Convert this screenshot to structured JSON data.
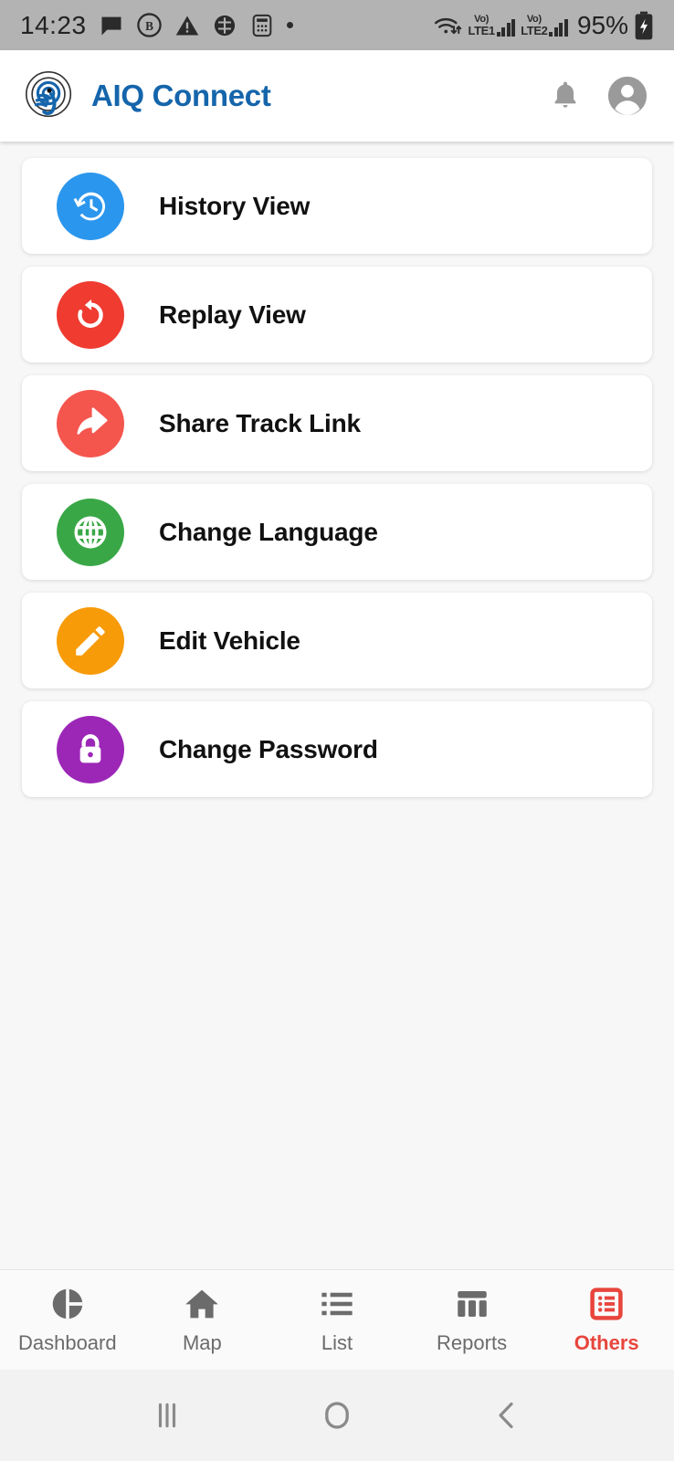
{
  "statusbar": {
    "time": "14:23",
    "battery_percent": "95%",
    "sim1_vo": "Vo)",
    "sim1_lte": "LTE1",
    "sim2_vo": "Vo)",
    "sim2_lte": "LTE2",
    "left_icons": [
      "message-bubble-icon",
      "bluetooth-b-badge-icon",
      "warning-triangle-icon",
      "circle-slash-icon",
      "calculator-icon",
      "dot-icon"
    ],
    "right_icons": [
      "wifi-transfer-icon",
      "signal-bars-icon",
      "signal-bars-icon",
      "battery-charging-icon"
    ]
  },
  "header": {
    "title": "AIQ Connect",
    "brand_color": "#1565ab",
    "logo_name": "aiq-connect-logo",
    "notification_icon": "bell-icon",
    "account_icon": "account-circle-icon",
    "icon_color": "#9a9a9a"
  },
  "menu": {
    "items": [
      {
        "label": "History View",
        "icon": "history-clock-icon",
        "color": "#2b96ed"
      },
      {
        "label": "Replay View",
        "icon": "replay-arrow-icon",
        "color": "#ef3b30"
      },
      {
        "label": "Share Track Link",
        "icon": "share-forward-icon",
        "color": "#f4564e"
      },
      {
        "label": "Change Language",
        "icon": "globe-icon",
        "color": "#3aa747"
      },
      {
        "label": "Edit Vehicle",
        "icon": "pencil-icon",
        "color": "#f79b09"
      },
      {
        "label": "Change Password",
        "icon": "lock-icon",
        "color": "#9c27b7"
      }
    ]
  },
  "bottom_nav": {
    "active_color": "#e8453c",
    "inactive_color": "#6b6b6b",
    "items": [
      {
        "label": "Dashboard",
        "icon": "pie-chart-icon",
        "active": false
      },
      {
        "label": "Map",
        "icon": "home-icon",
        "active": false
      },
      {
        "label": "List",
        "icon": "list-icon",
        "active": false
      },
      {
        "label": "Reports",
        "icon": "table-icon",
        "active": false
      },
      {
        "label": "Others",
        "icon": "list-box-icon",
        "active": true
      }
    ]
  },
  "system_nav": {
    "recents_icon": "recent-apps-icon",
    "home_icon": "home-button-icon",
    "back_icon": "back-chevron-icon"
  }
}
